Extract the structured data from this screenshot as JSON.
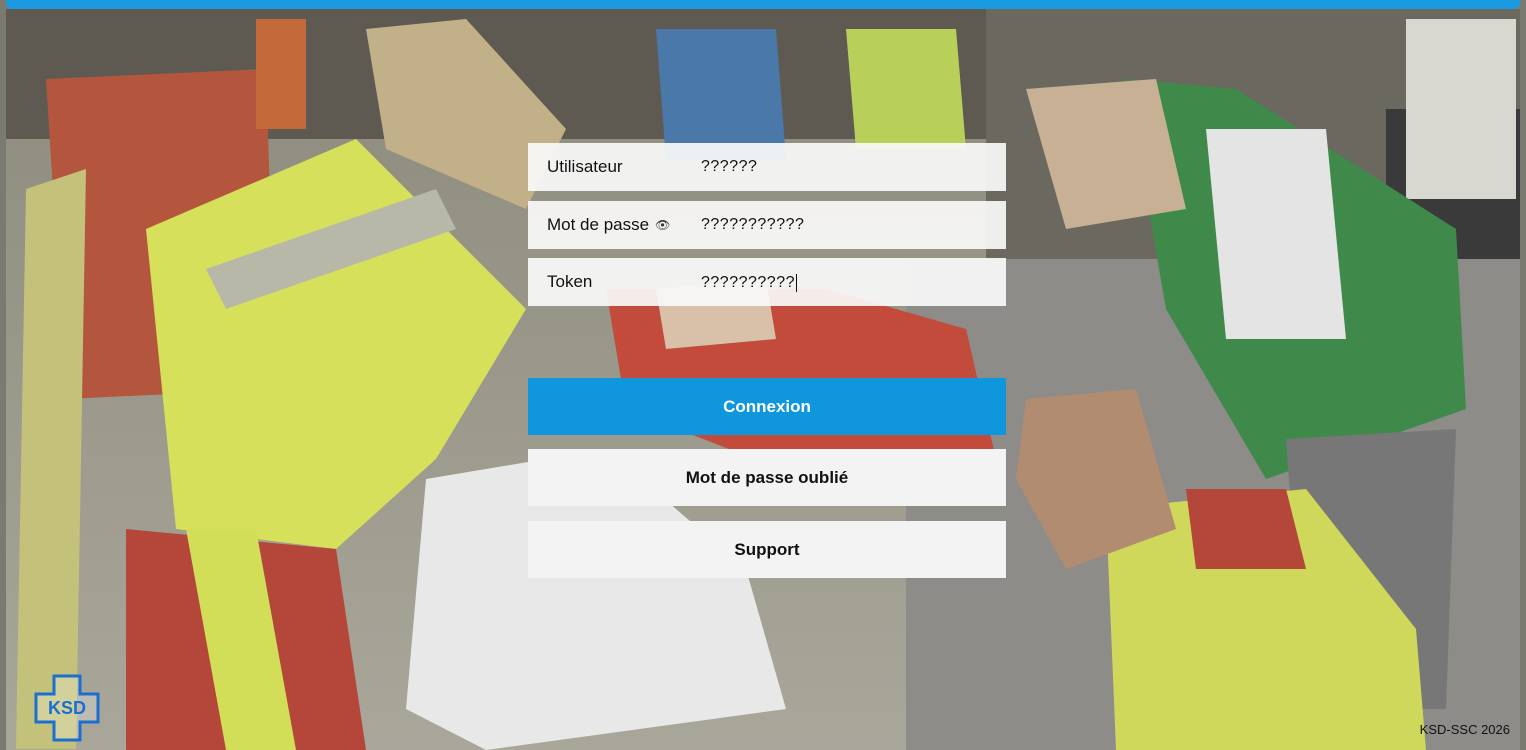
{
  "login": {
    "username_label": "Utilisateur",
    "username_value": "??????",
    "password_label": "Mot de passe",
    "password_value": "???????????",
    "token_label": "Token",
    "token_value": "??????????"
  },
  "buttons": {
    "connect": "Connexion",
    "forgot": "Mot de passe oublié",
    "support": "Support"
  },
  "footer": {
    "copyright": "KSD-SSC 2026"
  },
  "logo": {
    "letters": "KSD"
  },
  "icons": {
    "password_toggle": "eye-icon"
  },
  "colors": {
    "accent": "#1a9ae0",
    "primary_button": "#0f96dc"
  }
}
